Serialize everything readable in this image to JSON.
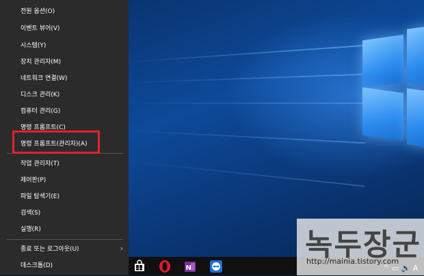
{
  "menu": {
    "items": [
      {
        "label": "전원 옵션(O)"
      },
      {
        "label": "이벤트 뷰어(V)"
      },
      {
        "label": "시스템(Y)"
      },
      {
        "label": "장치 관리자(M)"
      },
      {
        "label": "네트워크 연결(W)"
      },
      {
        "label": "디스크 관리(K)"
      },
      {
        "label": "컴퓨터 관리(G)"
      },
      {
        "label": "명령 프롬프트(C)"
      },
      {
        "label": "명령 프롬프트(관리자)(A)"
      },
      {
        "label": "작업 관리자(T)"
      },
      {
        "label": "제어판(P)"
      },
      {
        "label": "파일 탐색기(E)"
      },
      {
        "label": "검색(S)"
      },
      {
        "label": "실행(R)"
      },
      {
        "label": "종료 또는 로그아웃(U)"
      },
      {
        "label": "데스크톱(D)"
      }
    ],
    "submenu_arrow": "›"
  },
  "watermark": {
    "title": "녹두장군",
    "url": "http://mainia.tistory.com"
  },
  "taskbar": {
    "icons": [
      "windows-store-icon",
      "opera-icon",
      "onenote-icon",
      "teamviewer-icon"
    ],
    "tray_text": "^ ▭ 🔊 A"
  },
  "colors": {
    "menu_bg": "#2b2b2b",
    "highlight_border": "#e2232a",
    "taskbar_bg": "#101010"
  }
}
